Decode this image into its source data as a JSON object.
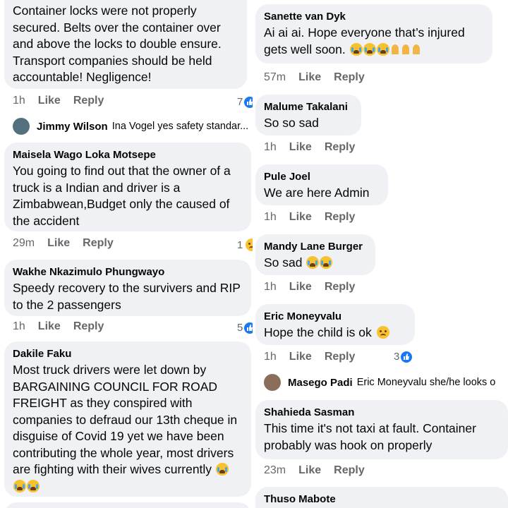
{
  "left": {
    "c1": {
      "text": "Container locks were not properly secured. Belts over the container over and above the locks to double ensure. Transport companies should be held accountable! Negligence!",
      "time": "1h",
      "like": "Like",
      "reply": "Reply",
      "reactions": "7"
    },
    "r1": {
      "name": "Jimmy Wilson",
      "text": "Ina Vogel  yes safety standar..."
    },
    "c2": {
      "name": "Maisela Wago Loka Motsepe",
      "text": "You going to find out that the owner of a truck is a Indian and driver is a Zimbabwean,Budget only the caused of the accident",
      "time": "29m",
      "like": "Like",
      "reply": "Reply",
      "reactions": "1"
    },
    "c3": {
      "name": "Wakhe Nkazimulo Phungwayo",
      "text": "Speedy recovery to the survivers and RIP to the 2 passengers",
      "time": "1h",
      "like": "Like",
      "reply": "Reply",
      "reactions": "5"
    },
    "c4": {
      "name": "Dakile Faku",
      "text": "Most truck drivers were let down by BARGAINING COUNCIL FOR ROAD FREIGHT as they conspired with companies to defraud our 13th cheque in disguise of Covid 19 yet we have been contributing the whole year, most drivers are fighting with their wives currently"
    }
  },
  "right": {
    "c1": {
      "name": "Sanette van Dyk",
      "text": "Ai ai ai.  Hope everyone that’s injured gets well soon.",
      "time": "57m",
      "like": "Like",
      "reply": "Reply"
    },
    "c2": {
      "name": "Malume Takalani",
      "text": "So so sad",
      "time": "1h",
      "like": "Like",
      "reply": "Reply"
    },
    "c3": {
      "name": "Pule Joel",
      "text": "We are here Admin",
      "time": "1h",
      "like": "Like",
      "reply": "Reply"
    },
    "c4": {
      "name": "Mandy Lane Burger",
      "text": "So sad",
      "time": "1h",
      "like": "Like",
      "reply": "Reply"
    },
    "c5": {
      "name": "Eric Moneyvalu",
      "text": "Hope the child is ok",
      "time": "1h",
      "like": "Like",
      "reply": "Reply",
      "reactions": "3"
    },
    "r1": {
      "name": "Masego Padi",
      "text": "Eric Moneyvalu she/he looks o"
    },
    "c6": {
      "name": "Shahieda Sasman",
      "text": "This time it's not taxi at fault. Container probably was hook on properly",
      "time": "23m",
      "like": "Like",
      "reply": "Reply"
    },
    "c7": {
      "name": "Thuso Mabote"
    }
  },
  "colors": {
    "bubble": "#eff1f4",
    "meta": "#65676b",
    "like_badge": "#1877f2"
  },
  "icons": {
    "reaction_like": "like-icon",
    "emoji_crying": "crying-face-icon",
    "emoji_sad": "sad-face-icon",
    "emoji_pray": "praying-hands-icon"
  }
}
